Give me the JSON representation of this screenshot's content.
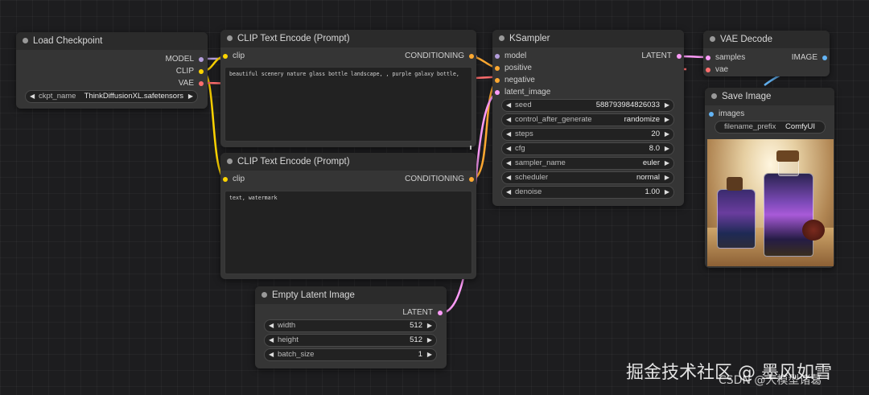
{
  "nodes": {
    "load_checkpoint": {
      "title": "Load Checkpoint",
      "outputs": [
        "MODEL",
        "CLIP",
        "VAE"
      ],
      "ckpt_name": {
        "name": "ckpt_name",
        "value": "ThinkDiffusionXL.safetensors"
      }
    },
    "clip_positive": {
      "title": "CLIP Text Encode (Prompt)",
      "input": "clip",
      "output": "CONDITIONING",
      "text": "beautiful scenery nature glass bottle landscape, , purple galaxy bottle,"
    },
    "clip_negative": {
      "title": "CLIP Text Encode (Prompt)",
      "input": "clip",
      "output": "CONDITIONING",
      "text": "text, watermark"
    },
    "ksampler": {
      "title": "KSampler",
      "inputs": [
        "model",
        "positive",
        "negative",
        "latent_image"
      ],
      "output": "LATENT",
      "widgets": [
        {
          "name": "seed",
          "value": "588793984826033"
        },
        {
          "name": "control_after_generate",
          "value": "randomize"
        },
        {
          "name": "steps",
          "value": "20"
        },
        {
          "name": "cfg",
          "value": "8.0"
        },
        {
          "name": "sampler_name",
          "value": "euler"
        },
        {
          "name": "scheduler",
          "value": "normal"
        },
        {
          "name": "denoise",
          "value": "1.00"
        }
      ]
    },
    "vae_decode": {
      "title": "VAE Decode",
      "inputs": [
        "samples",
        "vae"
      ],
      "output": "IMAGE"
    },
    "save_image": {
      "title": "Save Image",
      "input": "images",
      "filename_prefix": {
        "name": "filename_prefix",
        "value": "ComfyUI"
      }
    },
    "empty_latent": {
      "title": "Empty Latent Image",
      "output": "LATENT",
      "widgets": [
        {
          "name": "width",
          "value": "512"
        },
        {
          "name": "height",
          "value": "512"
        },
        {
          "name": "batch_size",
          "value": "1"
        }
      ]
    }
  },
  "colors": {
    "model": "#b39ddb",
    "clip": "#ffd500",
    "vae": "#ff6e6e",
    "conditioning": "#ffa931",
    "latent": "#ff9cf9",
    "image": "#64b5f6"
  },
  "watermark": {
    "line1": "掘金技术社区 @ 墨风如雪",
    "line2": "CSDN @大模型诸葛"
  }
}
